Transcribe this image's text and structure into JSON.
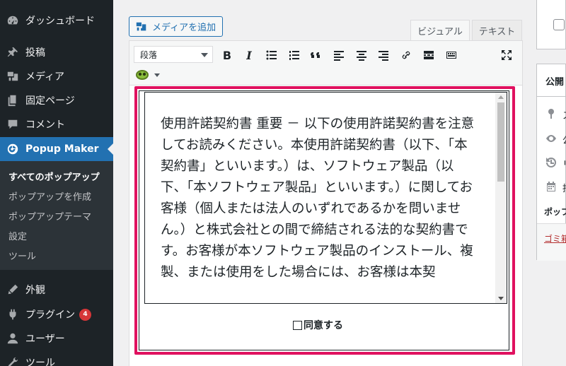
{
  "sidebar": {
    "items": [
      {
        "label": "ダッシュボード",
        "icon": "dashboard-icon"
      },
      {
        "label": "投稿",
        "icon": "pin-icon"
      },
      {
        "label": "メディア",
        "icon": "media-icon"
      },
      {
        "label": "固定ページ",
        "icon": "page-icon"
      },
      {
        "label": "コメント",
        "icon": "comment-icon"
      },
      {
        "label": "Popup Maker",
        "icon": "popup-maker-icon"
      },
      {
        "label": "外観",
        "icon": "appearance-icon"
      },
      {
        "label": "プラグイン",
        "icon": "plugin-icon",
        "badge": "4"
      },
      {
        "label": "ユーザー",
        "icon": "user-icon"
      },
      {
        "label": "ツール",
        "icon": "tool-icon"
      }
    ],
    "submenu": [
      "すべてのポップアップ",
      "ポップアップを作成",
      "ポップアップテーマ",
      "設定",
      "ツール"
    ]
  },
  "editor": {
    "add_media_label": "メディアを追加",
    "tabs": [
      "ビジュアル",
      "テキスト"
    ],
    "format_select": "段落",
    "toolbar_bold": "B",
    "toolbar_italic": "I",
    "license_text": "使用許諾契約書 重要 － 以下の使用許諾契約書を注意してお読みください。本使用許諾契約書（以下、「本契約書」といいます。）は、ソフトウェア製品（以下、「本ソフトウェア製品」といいます。）に関してお客様（個人または法人のいずれであるかを問いません。）と株式会社との間で締結される法的な契約書です。お客様が本ソフトウェア製品のインストール、複製、または使用をした場合には、お客様は本契",
    "agree_label": "同意する"
  },
  "publish": {
    "title": "公開",
    "frag1": "ス",
    "frag2": "公",
    "frag3": "リ",
    "frag4": "挿",
    "popup_label": "ポップ",
    "trash": "ゴミ箱"
  },
  "colors": {
    "sidebar_bg": "#1d2327",
    "active": "#2271b1",
    "highlight": "#e0115f",
    "badge": "#d63638"
  }
}
